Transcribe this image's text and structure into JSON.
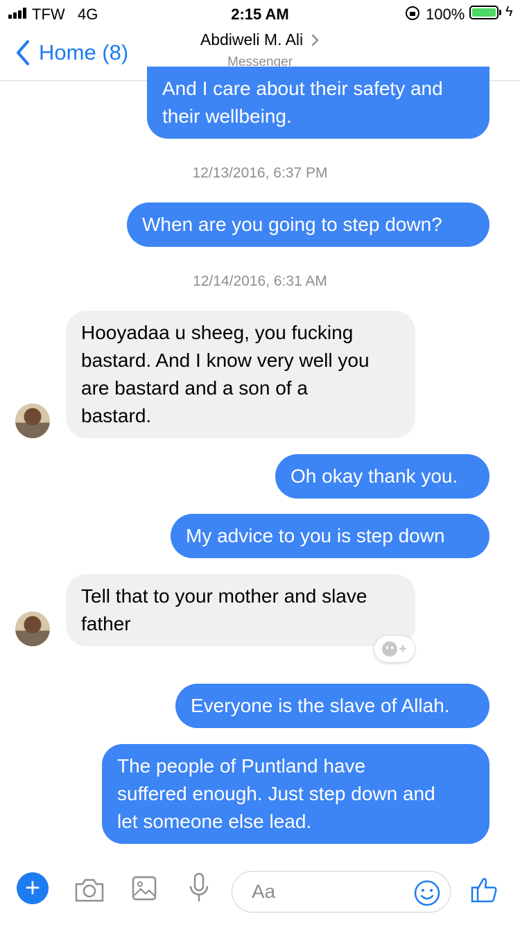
{
  "status_bar": {
    "carrier": "TFW",
    "network": "4G",
    "time": "2:15 AM",
    "battery": "100%"
  },
  "nav": {
    "back_label": "Home (8)",
    "title": "Abdiweli M. Ali",
    "subtitle": "Messenger"
  },
  "messages": [
    {
      "type": "out",
      "text_lines": [
        "And I care about their safety and",
        "their wellbeing."
      ]
    },
    {
      "type": "timestamp",
      "text": "12/13/2016, 6:37 PM"
    },
    {
      "type": "out",
      "text_lines": [
        "When are you going to step down?"
      ]
    },
    {
      "type": "timestamp",
      "text": "12/14/2016, 6:31 AM"
    },
    {
      "type": "in",
      "text_lines": [
        "Hooyadaa u sheeg, you fucking",
        "bastard. And I know very well you",
        "are bastard and a son of a",
        "bastard."
      ]
    },
    {
      "type": "out",
      "text_lines": [
        "Oh okay thank you."
      ]
    },
    {
      "type": "out",
      "text_lines": [
        "My advice to you is step down"
      ]
    },
    {
      "type": "in",
      "text_lines": [
        "Tell that to your mother and slave",
        "father"
      ]
    },
    {
      "type": "out",
      "text_lines": [
        "Everyone is the slave of Allah."
      ]
    },
    {
      "type": "out",
      "text_lines": [
        "The people of Puntland have",
        "suffered enough. Just step down and",
        "let someone else lead."
      ]
    }
  ],
  "composer": {
    "placeholder": "Aa"
  },
  "colors": {
    "accent": "#1e7cf2",
    "outgoing_bubble": "#3d84f4",
    "incoming_bubble": "#f0f0f0"
  },
  "icons": [
    "chevron-left-icon",
    "chevron-right-icon",
    "plus-icon",
    "camera-icon",
    "photo-icon",
    "microphone-icon",
    "smiley-icon",
    "thumbs-up-icon",
    "add-reaction-icon"
  ]
}
